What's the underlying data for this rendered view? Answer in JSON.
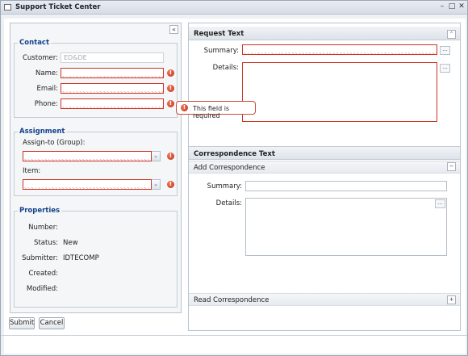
{
  "window": {
    "title": "Support Ticket Center",
    "controls": [
      "–",
      "□",
      "✕"
    ]
  },
  "left": {
    "collapse_glyph": "«",
    "contact": {
      "legend": "Contact",
      "customer_label": "Customer:",
      "customer_value": "ED&DE",
      "name_label": "Name:",
      "email_label": "Email:",
      "phone_label": "Phone:"
    },
    "assignment": {
      "legend": "Assignment",
      "group_label": "Assign-to (Group):",
      "item_label": "Item:"
    },
    "properties": {
      "legend": "Properties",
      "number_label": "Number:",
      "number_value": "",
      "status_label": "Status:",
      "status_value": "New",
      "submitter_label": "Submitter:",
      "submitter_value": "IDTECOMP",
      "created_label": "Created:",
      "created_value": "",
      "modified_label": "Modified:",
      "modified_value": ""
    }
  },
  "right": {
    "request": {
      "title": "Request Text",
      "summary_label": "Summary:",
      "details_label": "Details:"
    },
    "correspondence": {
      "title": "Correspondence Text",
      "add_title": "Add Correspondence",
      "summary_label": "Summary:",
      "details_label": "Details:",
      "read_title": "Read Correspondence"
    }
  },
  "tooltip": {
    "text": "This field is required",
    "icon": "!"
  },
  "icons": {
    "error": "!",
    "ellipsis": "...",
    "collapse_up": "⌃",
    "minus": "−",
    "plus": "+",
    "combo": "⌄"
  },
  "buttons": {
    "submit": "Submit",
    "cancel": "Cancel"
  }
}
